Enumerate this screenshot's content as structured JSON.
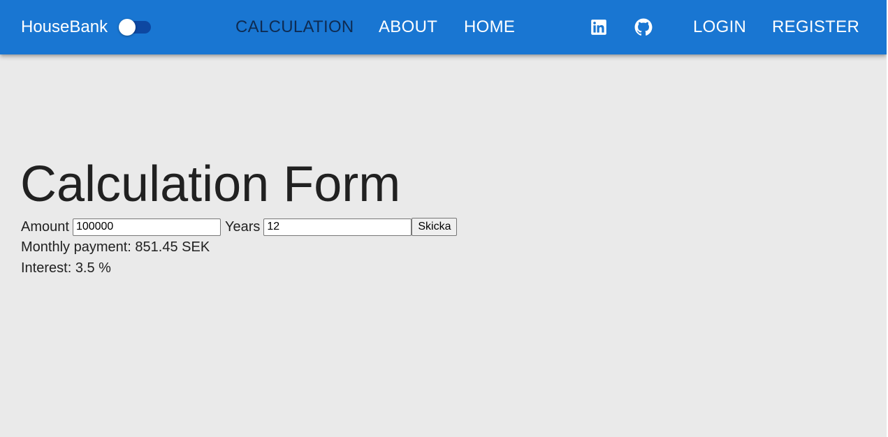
{
  "appbar": {
    "brand": "HouseBank",
    "theme_toggle_checked": false,
    "nav": [
      {
        "label": "CALCULATION",
        "active": true
      },
      {
        "label": "ABOUT",
        "active": false
      },
      {
        "label": "HOME",
        "active": false
      }
    ],
    "social_icons": [
      "linkedin-icon",
      "github-icon"
    ],
    "auth": {
      "login": "LOGIN",
      "register": "REGISTER"
    },
    "colors": {
      "bar": "#1976d2",
      "active_link": "#0e2b52",
      "toggle_track": "#0d47a1"
    }
  },
  "main": {
    "title": "Calculation Form",
    "form": {
      "amount_label": "Amount",
      "amount_value": "100000",
      "years_label": "Years",
      "years_value": "12",
      "submit_label": "Skicka"
    },
    "results": {
      "monthly_payment": "Monthly payment: 851.45 SEK",
      "interest": "Interest: 3.5 %"
    },
    "colors": {
      "background": "#eaeaea",
      "text": "#212121"
    }
  }
}
